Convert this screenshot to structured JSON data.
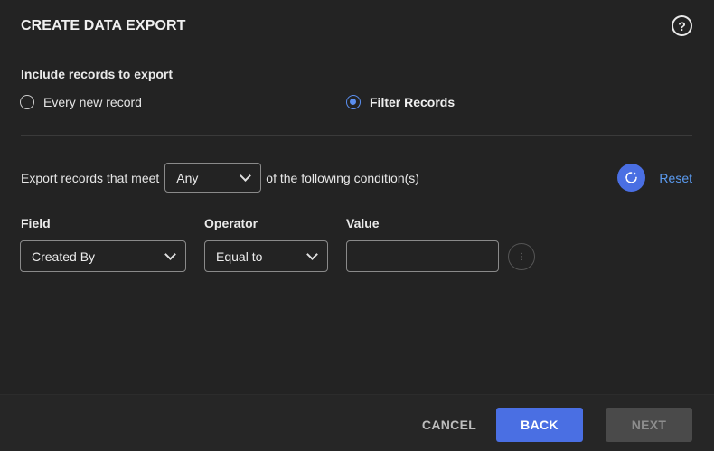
{
  "dialog": {
    "title": "CREATE DATA EXPORT",
    "help_icon": "help-circle-icon",
    "help_symbol": "?"
  },
  "include": {
    "label": "Include records to export",
    "options": [
      {
        "label": "Every new record",
        "checked": false
      },
      {
        "label": "Filter Records",
        "checked": true
      }
    ]
  },
  "conditions": {
    "prefix": "Export records that meet",
    "match_value": "Any",
    "suffix": "of the following condition(s)",
    "refresh_icon": "refresh-icon",
    "reset_label": "Reset",
    "columns": {
      "field": "Field",
      "operator": "Operator",
      "value": "Value"
    },
    "rows": [
      {
        "field": "Created By",
        "operator": "Equal to",
        "value": "",
        "more_icon": "more-options-icon",
        "more_symbol": "⋮"
      }
    ]
  },
  "footer": {
    "cancel_label": "CANCEL",
    "back_label": "BACK",
    "next_label": "NEXT"
  },
  "colors": {
    "background": "#232323",
    "accent": "#4a6fe3",
    "link": "#5b9bf0",
    "disabled_button": "#4a4a4a"
  }
}
